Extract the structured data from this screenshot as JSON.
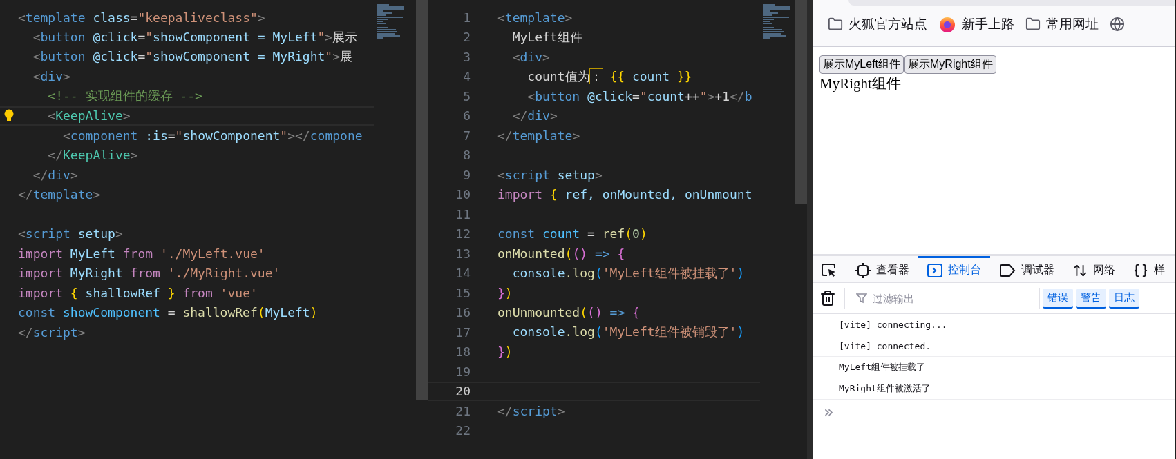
{
  "editors": [
    {
      "lines": [
        {
          "current": false,
          "segments": [
            {
              "text": "<",
              "color": "#808080"
            },
            {
              "text": "template",
              "color": "#569cd6"
            },
            {
              "text": " class",
              "color": "#9cdcfe"
            },
            {
              "text": "=",
              "color": "#d4d4d4"
            },
            {
              "text": "\"keepaliveclass\"",
              "color": "#ce9178"
            },
            {
              "text": ">",
              "color": "#808080"
            }
          ]
        },
        {
          "current": false,
          "segments": [
            {
              "text": "  <",
              "color": "#808080"
            },
            {
              "text": "button",
              "color": "#569cd6"
            },
            {
              "text": " @click",
              "color": "#9cdcfe"
            },
            {
              "text": "=",
              "color": "#d4d4d4"
            },
            {
              "text": "\"",
              "color": "#ce9178"
            },
            {
              "text": "showComponent = MyLeft",
              "color": "#9cdcfe"
            },
            {
              "text": "\"",
              "color": "#ce9178"
            },
            {
              "text": ">",
              "color": "#808080"
            },
            {
              "text": "展示",
              "color": "#d4d4d4"
            }
          ]
        },
        {
          "current": false,
          "segments": [
            {
              "text": "  <",
              "color": "#808080"
            },
            {
              "text": "button",
              "color": "#569cd6"
            },
            {
              "text": " @click",
              "color": "#9cdcfe"
            },
            {
              "text": "=",
              "color": "#d4d4d4"
            },
            {
              "text": "\"",
              "color": "#ce9178"
            },
            {
              "text": "showComponent = MyRight",
              "color": "#9cdcfe"
            },
            {
              "text": "\"",
              "color": "#ce9178"
            },
            {
              "text": ">",
              "color": "#808080"
            },
            {
              "text": "展",
              "color": "#d4d4d4"
            }
          ]
        },
        {
          "current": false,
          "segments": [
            {
              "text": "  <",
              "color": "#808080"
            },
            {
              "text": "div",
              "color": "#569cd6"
            },
            {
              "text": ">",
              "color": "#808080"
            }
          ]
        },
        {
          "current": false,
          "segments": [
            {
              "text": "    <!-- 实现组件的缓存 -->",
              "color": "#6a9955"
            }
          ]
        },
        {
          "current": true,
          "lightbulb": true,
          "segments": [
            {
              "text": "    <",
              "color": "#808080"
            },
            {
              "text": "KeepAlive",
              "color": "#4ec9b0"
            },
            {
              "text": ">",
              "color": "#808080"
            }
          ]
        },
        {
          "current": false,
          "segments": [
            {
              "text": "      <",
              "color": "#808080"
            },
            {
              "text": "component",
              "color": "#569cd6"
            },
            {
              "text": " :is",
              "color": "#9cdcfe"
            },
            {
              "text": "=",
              "color": "#d4d4d4"
            },
            {
              "text": "\"",
              "color": "#ce9178"
            },
            {
              "text": "showComponent",
              "color": "#9cdcfe"
            },
            {
              "text": "\"",
              "color": "#ce9178"
            },
            {
              "text": "></",
              "color": "#808080"
            },
            {
              "text": "compone",
              "color": "#569cd6"
            }
          ]
        },
        {
          "current": false,
          "segments": [
            {
              "text": "    </",
              "color": "#808080"
            },
            {
              "text": "KeepAlive",
              "color": "#4ec9b0"
            },
            {
              "text": ">",
              "color": "#808080"
            }
          ]
        },
        {
          "current": false,
          "segments": [
            {
              "text": "  </",
              "color": "#808080"
            },
            {
              "text": "div",
              "color": "#569cd6"
            },
            {
              "text": ">",
              "color": "#808080"
            }
          ]
        },
        {
          "current": false,
          "segments": [
            {
              "text": "</",
              "color": "#808080"
            },
            {
              "text": "template",
              "color": "#569cd6"
            },
            {
              "text": ">",
              "color": "#808080"
            }
          ]
        },
        {
          "current": false
        },
        {
          "current": false,
          "segments": [
            {
              "text": "<",
              "color": "#808080"
            },
            {
              "text": "script",
              "color": "#569cd6"
            },
            {
              "text": " setup",
              "color": "#9cdcfe"
            },
            {
              "text": ">",
              "color": "#808080"
            }
          ]
        },
        {
          "current": false,
          "segments": [
            {
              "text": "import",
              "color": "#c586c0"
            },
            {
              "text": " MyLeft ",
              "color": "#9cdcfe"
            },
            {
              "text": "from",
              "color": "#c586c0"
            },
            {
              "text": " './MyLeft.vue'",
              "color": "#ce9178"
            }
          ]
        },
        {
          "current": false,
          "segments": [
            {
              "text": "import",
              "color": "#c586c0"
            },
            {
              "text": " MyRight ",
              "color": "#9cdcfe"
            },
            {
              "text": "from",
              "color": "#c586c0"
            },
            {
              "text": " './MyRight.vue'",
              "color": "#ce9178"
            }
          ]
        },
        {
          "current": false,
          "segments": [
            {
              "text": "import ",
              "color": "#c586c0"
            },
            {
              "text": "{",
              "color": "#ffd700"
            },
            {
              "text": " shallowRef ",
              "color": "#9cdcfe"
            },
            {
              "text": "}",
              "color": "#ffd700"
            },
            {
              "text": " from",
              "color": "#c586c0"
            },
            {
              "text": " 'vue'",
              "color": "#ce9178"
            }
          ]
        },
        {
          "current": false,
          "segments": [
            {
              "text": "const",
              "color": "#569cd6"
            },
            {
              "text": " showComponent",
              "color": "#4fc1ff"
            },
            {
              "text": " = ",
              "color": "#d4d4d4"
            },
            {
              "text": "shallowRef",
              "color": "#dcdcaa"
            },
            {
              "text": "(",
              "color": "#ffd700"
            },
            {
              "text": "MyLeft",
              "color": "#9cdcfe"
            },
            {
              "text": ")",
              "color": "#ffd700"
            }
          ]
        },
        {
          "current": false,
          "segments": [
            {
              "text": "</",
              "color": "#808080"
            },
            {
              "text": "script",
              "color": "#569cd6"
            },
            {
              "text": ">",
              "color": "#808080"
            }
          ]
        }
      ]
    },
    {
      "lines": [
        {
          "number": "1",
          "current": false,
          "segments": [
            {
              "text": "<",
              "color": "#808080"
            },
            {
              "text": "template",
              "color": "#569cd6"
            },
            {
              "text": ">",
              "color": "#808080"
            }
          ]
        },
        {
          "number": "2",
          "current": false,
          "segments": [
            {
              "text": "  MyLeft组件",
              "color": "#d4d4d4"
            }
          ]
        },
        {
          "number": "3",
          "current": false,
          "segments": [
            {
              "text": "  <",
              "color": "#808080"
            },
            {
              "text": "div",
              "color": "#569cd6"
            },
            {
              "text": ">",
              "color": "#808080"
            }
          ]
        },
        {
          "number": "4",
          "current": false,
          "segments": [
            {
              "text": "    count值为",
              "color": "#d4d4d4"
            },
            {
              "text": "：",
              "color": "#d4d4d4",
              "boxed": true
            },
            {
              "text": " {{",
              "color": "#ffd700"
            },
            {
              "text": " count ",
              "color": "#9cdcfe"
            },
            {
              "text": "}}",
              "color": "#ffd700"
            }
          ]
        },
        {
          "number": "5",
          "current": false,
          "segments": [
            {
              "text": "    <",
              "color": "#808080"
            },
            {
              "text": "button",
              "color": "#569cd6"
            },
            {
              "text": " @click",
              "color": "#9cdcfe"
            },
            {
              "text": "=",
              "color": "#d4d4d4"
            },
            {
              "text": "\"",
              "color": "#ce9178"
            },
            {
              "text": "count",
              "color": "#9cdcfe"
            },
            {
              "text": "++",
              "color": "#d4d4d4"
            },
            {
              "text": "\"",
              "color": "#ce9178"
            },
            {
              "text": ">",
              "color": "#808080"
            },
            {
              "text": "+1",
              "color": "#d4d4d4"
            },
            {
              "text": "</",
              "color": "#808080"
            },
            {
              "text": "b",
              "color": "#569cd6"
            }
          ]
        },
        {
          "number": "6",
          "current": false,
          "segments": [
            {
              "text": "  </",
              "color": "#808080"
            },
            {
              "text": "div",
              "color": "#569cd6"
            },
            {
              "text": ">",
              "color": "#808080"
            }
          ]
        },
        {
          "number": "7",
          "current": false,
          "segments": [
            {
              "text": "</",
              "color": "#808080"
            },
            {
              "text": "template",
              "color": "#569cd6"
            },
            {
              "text": ">",
              "color": "#808080"
            }
          ]
        },
        {
          "number": "8",
          "current": false
        },
        {
          "number": "9",
          "current": false,
          "segments": [
            {
              "text": "<",
              "color": "#808080"
            },
            {
              "text": "script",
              "color": "#569cd6"
            },
            {
              "text": " setup",
              "color": "#9cdcfe"
            },
            {
              "text": ">",
              "color": "#808080"
            }
          ]
        },
        {
          "number": "10",
          "current": false,
          "segments": [
            {
              "text": "import ",
              "color": "#c586c0"
            },
            {
              "text": "{",
              "color": "#ffd700"
            },
            {
              "text": " ref, onMounted, onUnmount",
              "color": "#9cdcfe"
            }
          ]
        },
        {
          "number": "11",
          "current": false
        },
        {
          "number": "12",
          "current": false,
          "segments": [
            {
              "text": "const",
              "color": "#569cd6"
            },
            {
              "text": " count",
              "color": "#4fc1ff"
            },
            {
              "text": " = ",
              "color": "#d4d4d4"
            },
            {
              "text": "ref",
              "color": "#dcdcaa"
            },
            {
              "text": "(",
              "color": "#ffd700"
            },
            {
              "text": "0",
              "color": "#b5cea8"
            },
            {
              "text": ")",
              "color": "#ffd700"
            }
          ]
        },
        {
          "number": "13",
          "current": false,
          "segments": [
            {
              "text": "onMounted",
              "color": "#dcdcaa"
            },
            {
              "text": "(",
              "color": "#ffd700"
            },
            {
              "text": "()",
              "color": "#da70d6"
            },
            {
              "text": " => ",
              "color": "#569cd6"
            },
            {
              "text": "{",
              "color": "#da70d6"
            }
          ]
        },
        {
          "number": "14",
          "current": false,
          "segments": [
            {
              "text": "  console",
              "color": "#9cdcfe"
            },
            {
              "text": ".log",
              "color": "#dcdcaa"
            },
            {
              "text": "(",
              "color": "#179fff"
            },
            {
              "text": "'MyLeft组件被挂载了'",
              "color": "#ce9178"
            },
            {
              "text": ")",
              "color": "#179fff"
            }
          ]
        },
        {
          "number": "15",
          "current": false,
          "segments": [
            {
              "text": "}",
              "color": "#da70d6"
            },
            {
              "text": ")",
              "color": "#ffd700"
            }
          ]
        },
        {
          "number": "16",
          "current": false,
          "segments": [
            {
              "text": "onUnmounted",
              "color": "#dcdcaa"
            },
            {
              "text": "(",
              "color": "#ffd700"
            },
            {
              "text": "()",
              "color": "#da70d6"
            },
            {
              "text": " => ",
              "color": "#569cd6"
            },
            {
              "text": "{",
              "color": "#da70d6"
            }
          ]
        },
        {
          "number": "17",
          "current": false,
          "segments": [
            {
              "text": "  console",
              "color": "#9cdcfe"
            },
            {
              "text": ".log",
              "color": "#dcdcaa"
            },
            {
              "text": "(",
              "color": "#179fff"
            },
            {
              "text": "'MyLeft组件被销毁了'",
              "color": "#ce9178"
            },
            {
              "text": ")",
              "color": "#179fff"
            }
          ]
        },
        {
          "number": "18",
          "current": false,
          "segments": [
            {
              "text": "}",
              "color": "#da70d6"
            },
            {
              "text": ")",
              "color": "#ffd700"
            }
          ]
        },
        {
          "number": "19",
          "current": false
        },
        {
          "number": "20",
          "current": true
        },
        {
          "number": "21",
          "current": false,
          "segments": [
            {
              "text": "</",
              "color": "#808080"
            },
            {
              "text": "script",
              "color": "#569cd6"
            },
            {
              "text": ">",
              "color": "#808080"
            }
          ]
        },
        {
          "number": "22",
          "current": false
        }
      ]
    }
  ],
  "browser": {
    "bookmarks": [
      {
        "kind": "folder",
        "label": "火狐官方站点"
      },
      {
        "kind": "firefox",
        "label": "新手上路"
      },
      {
        "kind": "folder",
        "label": "常用网址"
      },
      {
        "kind": "globe"
      }
    ],
    "page": {
      "buttons": [
        "展示MyLeft组件",
        "展示MyRight组件"
      ],
      "text": "MyRight组件"
    },
    "devtools": {
      "tabs": [
        {
          "kind": "pick",
          "selected": false
        },
        {
          "kind": "inspector",
          "label": "查看器",
          "selected": false
        },
        {
          "kind": "console",
          "label": "控制台",
          "selected": true
        },
        {
          "kind": "debugger",
          "label": "调试器",
          "selected": false
        },
        {
          "kind": "network",
          "label": "网络",
          "selected": false
        },
        {
          "kind": "style",
          "label": "样",
          "selected": false
        }
      ],
      "filter": {
        "placeholder": "过滤输出"
      },
      "levels": [
        {
          "label": "错误",
          "selected": true
        },
        {
          "label": "警告",
          "selected": true
        },
        {
          "label": "日志",
          "selected": true
        }
      ],
      "messages": [
        "[vite] connecting...",
        "[vite] connected.",
        "MyLeft组件被挂载了",
        "MyRight组件被激活了"
      ],
      "prompt": "»"
    }
  }
}
